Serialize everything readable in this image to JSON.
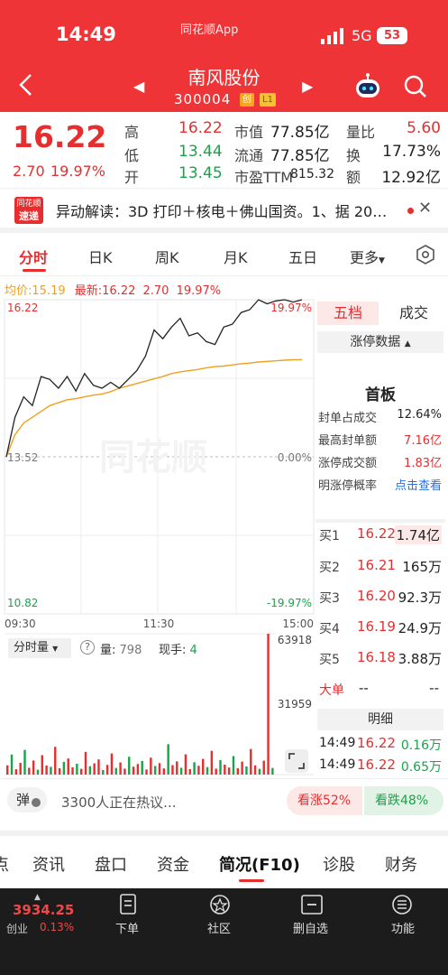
{
  "status_bar": {
    "time": "14:49",
    "app": "同花顺App",
    "network": "5G",
    "battery": "53"
  },
  "header": {
    "stock_name": "南风股份",
    "stock_code": "300004",
    "tag_1": "创",
    "tag_2": "L1"
  },
  "quote": {
    "price": "16.22",
    "change": "2.70",
    "change_pct": "19.97%",
    "high_label": "高",
    "high": "16.22",
    "low_label": "低",
    "low": "13.44",
    "open_label": "开",
    "open": "13.45",
    "mktcap_label": "市值",
    "mktcap": "77.85亿",
    "float_label": "流通",
    "float": "77.85亿",
    "pe_label": "市盈TTM",
    "pe": "815.32",
    "volratio_label": "量比",
    "volratio": "5.60",
    "turnover_label": "换",
    "turnover": "17.73%",
    "amount_label": "额",
    "amount": "12.92亿"
  },
  "news": {
    "logo_top": "同花顺",
    "logo_bottom": "速递",
    "text": "异动解读：3D 打印＋核电＋佛山国资。1、据 20…"
  },
  "period_tabs": [
    "分时",
    "日K",
    "周K",
    "月K",
    "五日",
    "更多"
  ],
  "chart_legend": {
    "avg_label": "均价:",
    "avg": "15.19",
    "latest_label": "最新:",
    "latest": "16.22",
    "change": "2.70",
    "change_pct": "19.97%"
  },
  "chart_data": {
    "type": "line",
    "x_ticks": [
      "09:30",
      "11:30",
      "15:00"
    ],
    "y_labels_left": [
      "16.22",
      "13.52",
      "10.82"
    ],
    "y_labels_right": [
      "19.97%",
      "0.00%",
      "-19.97%"
    ],
    "ylim": [
      10.82,
      16.22
    ],
    "series": [
      {
        "values": [
          13.52,
          14.2,
          14.55,
          14.4,
          14.9,
          14.85,
          14.7,
          14.9,
          14.65,
          14.95,
          14.75,
          14.7,
          14.8,
          14.7,
          14.85,
          15.0,
          15.25,
          15.7,
          15.55,
          15.75,
          15.9,
          15.6,
          15.65,
          15.5,
          15.45,
          15.75,
          15.8,
          16.0,
          16.05,
          16.22,
          16.15,
          16.2,
          16.22,
          16.18,
          16.22
        ]
      },
      {
        "values": [
          13.52,
          13.9,
          14.1,
          14.2,
          14.3,
          14.4,
          14.45,
          14.5,
          14.52,
          14.55,
          14.58,
          14.6,
          14.64,
          14.7,
          14.74,
          14.78,
          14.82,
          14.86,
          14.9,
          14.95,
          14.98,
          15.0,
          15.02,
          15.05,
          15.07,
          15.08,
          15.1,
          15.12,
          15.13,
          15.15,
          15.16,
          15.17,
          15.18,
          15.19,
          15.19
        ]
      }
    ],
    "volume": {
      "label": "分时量",
      "vol_label": "量:",
      "vol": "798",
      "hand_label": "现手:",
      "hand": "4",
      "y_labels": [
        "63918",
        "31959"
      ],
      "ymax": 63918,
      "values": [
        4200,
        9100,
        2400,
        5300,
        11200,
        3100,
        6400,
        2200,
        8800,
        4100,
        3500,
        12600,
        2900,
        5800,
        7300,
        3300,
        4900,
        2600,
        10300,
        3800,
        5100,
        6900,
        2100,
        4400,
        9600,
        3000,
        5500,
        2700,
        8100,
        3600,
        4800,
        6200,
        2300,
        7700,
        3900,
        5200,
        2800,
        13800,
        4300,
        6000,
        3100,
        9200,
        2500,
        5600,
        4000,
        7100,
        3400,
        10800,
        2700,
        6600,
        4500,
        3200,
        8400,
        2900,
        5900,
        3700,
        11600,
        4200,
        2600,
        6300,
        63918,
        3000
      ]
    }
  },
  "right_panel": {
    "tab_1": "五档",
    "tab_2": "成交",
    "limit_data": "涨停数据",
    "first_board": "首板",
    "stats": [
      {
        "label": "封单占成交",
        "value": "12.64%"
      },
      {
        "label": "最高封单额",
        "value": "7.16亿"
      },
      {
        "label": "涨停成交额",
        "value": "1.83亿"
      },
      {
        "label": "明涨停概率",
        "value": "点击查看"
      }
    ],
    "bids": [
      {
        "label": "买1",
        "price": "16.22",
        "vol": "1.74亿"
      },
      {
        "label": "买2",
        "price": "16.21",
        "vol": "165万"
      },
      {
        "label": "买3",
        "price": "16.20",
        "vol": "92.3万"
      },
      {
        "label": "买4",
        "price": "16.19",
        "vol": "24.9万"
      },
      {
        "label": "买5",
        "price": "16.18",
        "vol": "3.88万"
      }
    ],
    "big_label": "大单",
    "big_1": "--",
    "big_2": "--",
    "detail_label": "明细",
    "details": [
      {
        "time": "14:49",
        "price": "16.22",
        "vol": "0.16万"
      },
      {
        "time": "14:49",
        "price": "16.22",
        "vol": "0.65万"
      }
    ]
  },
  "hot": {
    "danmu": "弹",
    "text": "3300人正在热议...",
    "up": "看涨52%",
    "down": "看跌48%"
  },
  "section_tabs": [
    "点",
    "资讯",
    "盘口",
    "资金",
    "简况(F10)",
    "诊股",
    "财务"
  ],
  "bottom_nav": {
    "index_value": "3934.25",
    "index_name": "创业",
    "index_pct": "0.13%",
    "items": [
      "下单",
      "社区",
      "删自选",
      "功能"
    ]
  },
  "colors": {
    "up": "#e62e2e",
    "down": "#1aa34a",
    "brand": "#ee3436",
    "avg_line": "#f0a020"
  }
}
